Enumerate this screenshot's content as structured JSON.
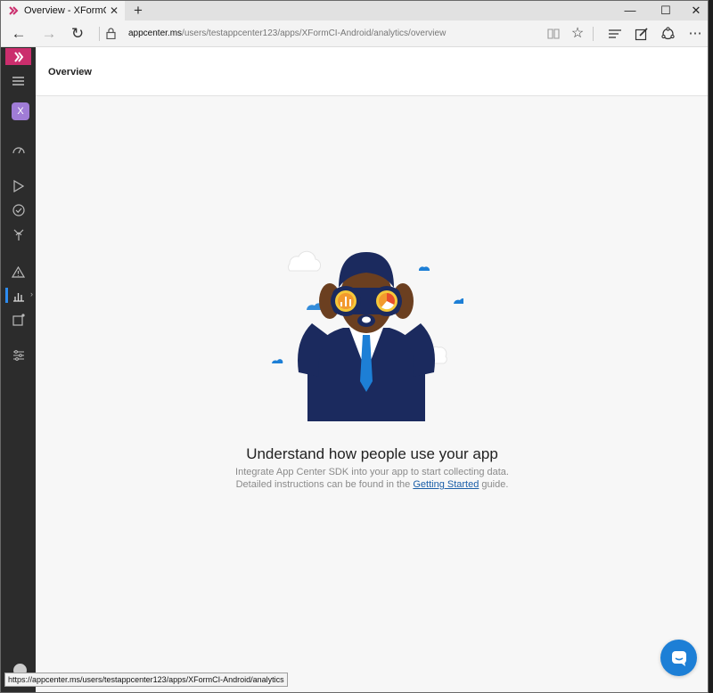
{
  "browser": {
    "tab_title": "Overview - XFormCI-Andr",
    "tab_close": "✕",
    "new_tab": "+",
    "url_host": "appcenter.ms",
    "url_path": "/users/testappcenter123/apps/XFormCI-Android/analytics/overview",
    "status_url": "https://appcenter.ms/users/testappcenter123/apps/XFormCI-Android/analytics"
  },
  "colors": {
    "brand": "#cb2e6d",
    "accent": "#1d7fd6",
    "sidebar": "#2c2c2c",
    "app_badge": "#a07cd6"
  },
  "sidebar": {
    "app_initial": "X"
  },
  "header": {
    "title": "Overview"
  },
  "empty_state": {
    "title": "Understand how people use your app",
    "line1": "Integrate App Center SDK into your app to start collecting data.",
    "line2_prefix": "Detailed instructions can be found in the ",
    "link_text": "Getting Started",
    "line2_suffix": " guide."
  }
}
